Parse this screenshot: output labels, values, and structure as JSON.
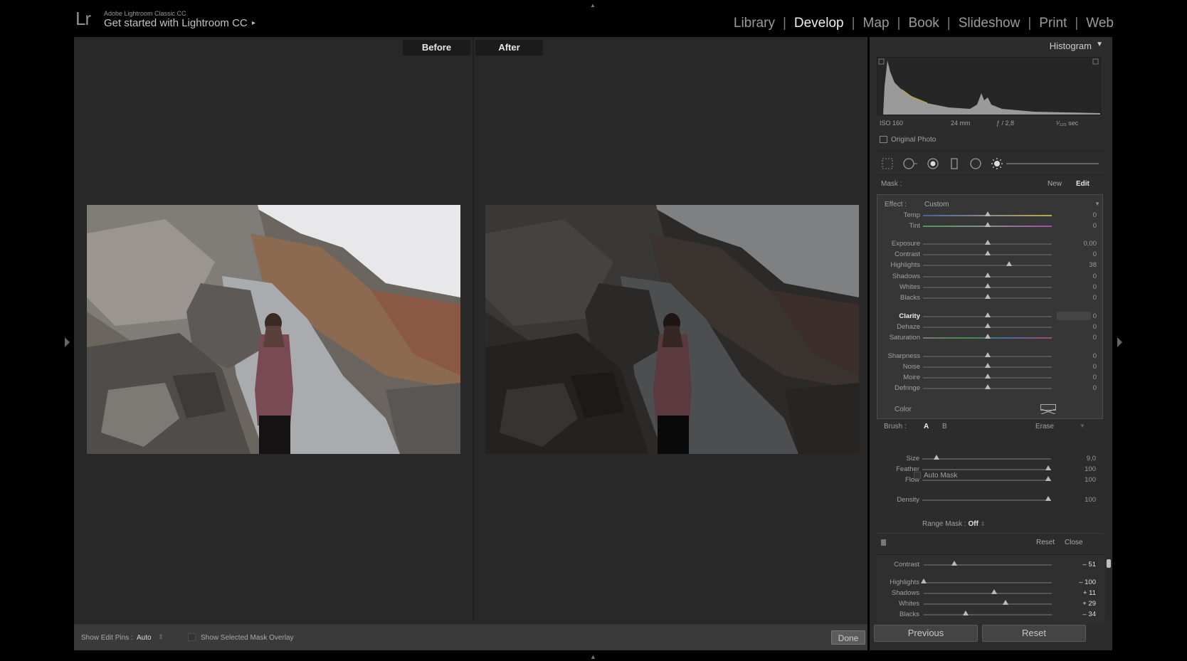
{
  "app": {
    "logo": "Lr",
    "product": "Adobe Lightroom Classic CC",
    "title": "Get started with Lightroom CC",
    "arrow": "▸"
  },
  "modules": [
    {
      "label": "Library",
      "active": false
    },
    {
      "label": "Develop",
      "active": true
    },
    {
      "label": "Map",
      "active": false
    },
    {
      "label": "Book",
      "active": false
    },
    {
      "label": "Slideshow",
      "active": false
    },
    {
      "label": "Print",
      "active": false
    },
    {
      "label": "Web",
      "active": false
    }
  ],
  "view": {
    "before_label": "Before",
    "after_label": "After"
  },
  "toolbar": {
    "show_pins_label": "Show Edit Pins :",
    "show_pins_value": "Auto",
    "overlay_label": "Show Selected Mask Overlay",
    "done_label": "Done"
  },
  "histogram": {
    "title": "Histogram",
    "iso": "ISO 160",
    "focal": "24 mm",
    "aperture": "ƒ / 2,8",
    "shutter": "¹⁄₁₂₅ sec",
    "original_photo": "Original Photo"
  },
  "mask": {
    "label": "Mask :",
    "new_label": "New",
    "edit_label": "Edit"
  },
  "effect": {
    "label": "Effect :",
    "value": "Custom",
    "color_label": "Color",
    "sliders": [
      {
        "label": "Temp",
        "value": "0",
        "pos": 0.5,
        "track": "temp"
      },
      {
        "label": "Tint",
        "value": "0",
        "pos": 0.5,
        "track": "tint"
      },
      {
        "label": "Exposure",
        "value": "0,00",
        "pos": 0.5,
        "track": "plain"
      },
      {
        "label": "Contrast",
        "value": "0",
        "pos": 0.5,
        "track": "plain"
      },
      {
        "label": "Highlights",
        "value": "38",
        "pos": 0.67,
        "track": "plain"
      },
      {
        "label": "Shadows",
        "value": "0",
        "pos": 0.5,
        "track": "plain"
      },
      {
        "label": "Whites",
        "value": "0",
        "pos": 0.5,
        "track": "plain"
      },
      {
        "label": "Blacks",
        "value": "0",
        "pos": 0.5,
        "track": "plain"
      },
      {
        "label": "Clarity",
        "value": "0",
        "pos": 0.5,
        "track": "plain",
        "active": true
      },
      {
        "label": "Dehaze",
        "value": "0",
        "pos": 0.5,
        "track": "plain"
      },
      {
        "label": "Saturation",
        "value": "0",
        "pos": 0.5,
        "track": "sat"
      },
      {
        "label": "Sharpness",
        "value": "0",
        "pos": 0.5,
        "track": "plain"
      },
      {
        "label": "Noise",
        "value": "0",
        "pos": 0.5,
        "track": "plain"
      },
      {
        "label": "Moire",
        "value": "0",
        "pos": 0.5,
        "track": "plain"
      },
      {
        "label": "Defringe",
        "value": "0",
        "pos": 0.5,
        "track": "plain"
      }
    ]
  },
  "brush": {
    "label": "Brush :",
    "a_label": "A",
    "b_label": "B",
    "erase_label": "Erase",
    "auto_mask_label": "Auto Mask",
    "sliders": [
      {
        "label": "Size",
        "value": "9,0",
        "pos": 0.11
      },
      {
        "label": "Feather",
        "value": "100",
        "pos": 0.98
      },
      {
        "label": "Flow",
        "value": "100",
        "pos": 0.98
      },
      {
        "label": "Density",
        "value": "100",
        "pos": 0.98
      }
    ]
  },
  "range_mask": {
    "label": "Range Mask :",
    "value": "Off"
  },
  "mask_footer": {
    "reset_label": "Reset",
    "close_label": "Close"
  },
  "basic": {
    "sliders": [
      {
        "label": "Contrast",
        "value": "– 51",
        "pos": 0.24
      },
      {
        "label": "Highlights",
        "value": "– 100",
        "pos": 0.0
      },
      {
        "label": "Shadows",
        "value": "+ 11",
        "pos": 0.55
      },
      {
        "label": "Whites",
        "value": "+ 29",
        "pos": 0.64
      },
      {
        "label": "Blacks",
        "value": "– 34",
        "pos": 0.33
      }
    ]
  },
  "footer": {
    "previous_label": "Previous",
    "reset_label": "Reset"
  }
}
